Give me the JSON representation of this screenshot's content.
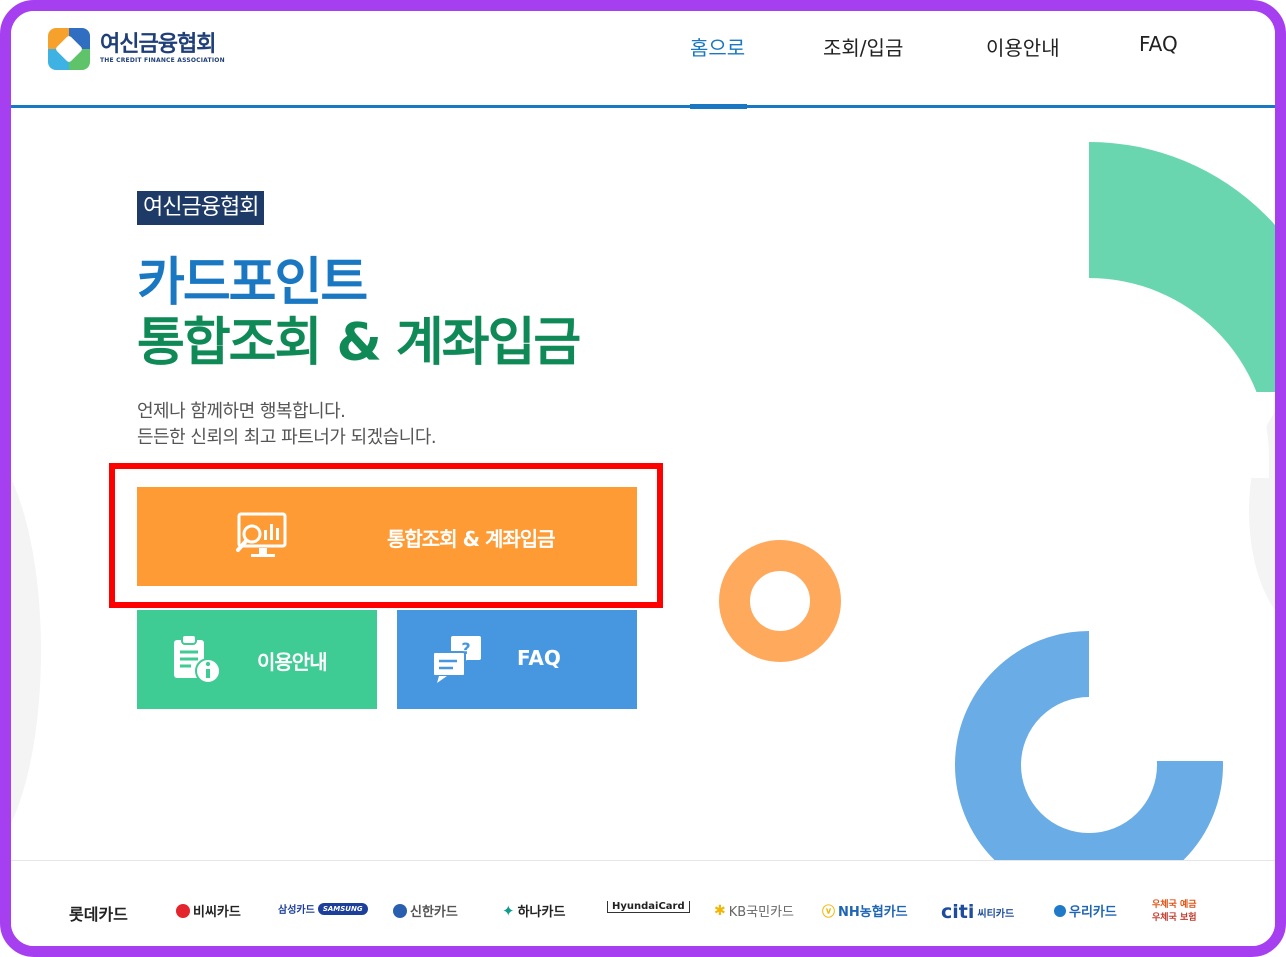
{
  "header": {
    "logo_ko": "여신금융협회",
    "logo_en": "THE CREDIT FINANCE ASSOCIATION",
    "nav": [
      {
        "label": "홈으로",
        "active": true
      },
      {
        "label": "조회/입금",
        "active": false
      },
      {
        "label": "이용안내",
        "active": false
      },
      {
        "label": "FAQ",
        "active": false
      }
    ]
  },
  "hero": {
    "badge": "여신금융협회",
    "title_line1": "카드포인트",
    "title_line2": "통합조회 & 계좌입금",
    "sub_line1": "언제나 함께하면 행복합니다.",
    "sub_line2": "든든한 신뢰의 최고 파트너가 되겠습니다."
  },
  "buttons": {
    "main": {
      "label": "통합조회 & 계좌입금",
      "icon": "search-monitor-icon",
      "color": "#ff9b34"
    },
    "guide": {
      "label": "이용안내",
      "icon": "clipboard-info-icon",
      "color": "#3fcb94"
    },
    "faq": {
      "label": "FAQ",
      "icon": "chat-question-icon",
      "color": "#4696e0"
    }
  },
  "footer": {
    "cards": [
      {
        "name": "롯데카드"
      },
      {
        "name": "비씨카드"
      },
      {
        "name": "삼성카드",
        "sub": "SAMSUNG"
      },
      {
        "name": "신한카드"
      },
      {
        "name": "하나카드"
      },
      {
        "name": "HyundaiCard"
      },
      {
        "name": "KB국민카드"
      },
      {
        "name": "NH농협카드"
      },
      {
        "name": "citi",
        "sub": "씨티카드"
      },
      {
        "name": "우리카드"
      },
      {
        "name": "우체국 예금",
        "sub": "우체국 보험"
      }
    ]
  },
  "colors": {
    "accent_blue": "#1a78c2",
    "accent_green": "#0f8a57",
    "frame": "#a63ff0",
    "highlight": "#ff0000"
  }
}
